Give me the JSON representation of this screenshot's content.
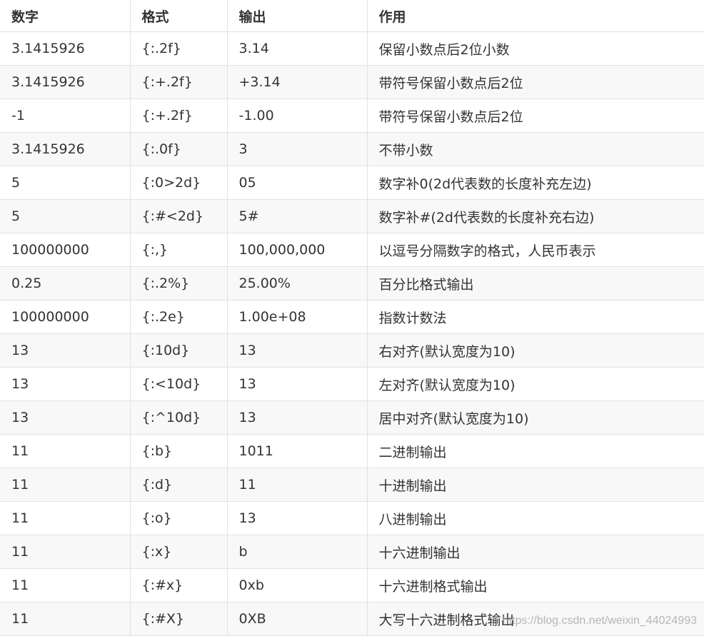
{
  "table": {
    "headers": [
      "数字",
      "格式",
      "输出",
      "作用"
    ],
    "rows": [
      [
        "3.1415926",
        "{:.2f}",
        "3.14",
        "保留小数点后2位小数"
      ],
      [
        "3.1415926",
        "{:+.2f}",
        "+3.14",
        "带符号保留小数点后2位"
      ],
      [
        "-1",
        "{:+.2f}",
        "-1.00",
        "带符号保留小数点后2位"
      ],
      [
        "3.1415926",
        "{:.0f}",
        "3",
        "不带小数"
      ],
      [
        "5",
        "{:0>2d}",
        "05",
        "数字补0(2d代表数的长度补充左边)"
      ],
      [
        "5",
        "{:#<2d}",
        "5#",
        "数字补#(2d代表数的长度补充右边)"
      ],
      [
        "100000000",
        "{:,}",
        "100,000,000",
        "以逗号分隔数字的格式，人民币表示"
      ],
      [
        "0.25",
        "{:.2%}",
        "25.00%",
        "百分比格式输出"
      ],
      [
        "100000000",
        "{:.2e}",
        "1.00e+08",
        "指数计数法"
      ],
      [
        "13",
        "{:10d}",
        "13",
        "右对齐(默认宽度为10)"
      ],
      [
        "13",
        "{:<10d}",
        "13",
        "左对齐(默认宽度为10)"
      ],
      [
        "13",
        "{:^10d}",
        "13",
        "居中对齐(默认宽度为10)"
      ],
      [
        "11",
        "{:b}",
        "1011",
        "二进制输出"
      ],
      [
        "11",
        "{:d}",
        "11",
        "十进制输出"
      ],
      [
        "11",
        "{:o}",
        "13",
        "八进制输出"
      ],
      [
        "11",
        "{:x}",
        "b",
        "十六进制输出"
      ],
      [
        "11",
        "{:#x}",
        "0xb",
        "十六进制格式输出"
      ],
      [
        "11",
        "{:#X}",
        "0XB",
        "大写十六进制格式输出"
      ]
    ]
  },
  "watermark": "https://blog.csdn.net/weixin_44024993"
}
